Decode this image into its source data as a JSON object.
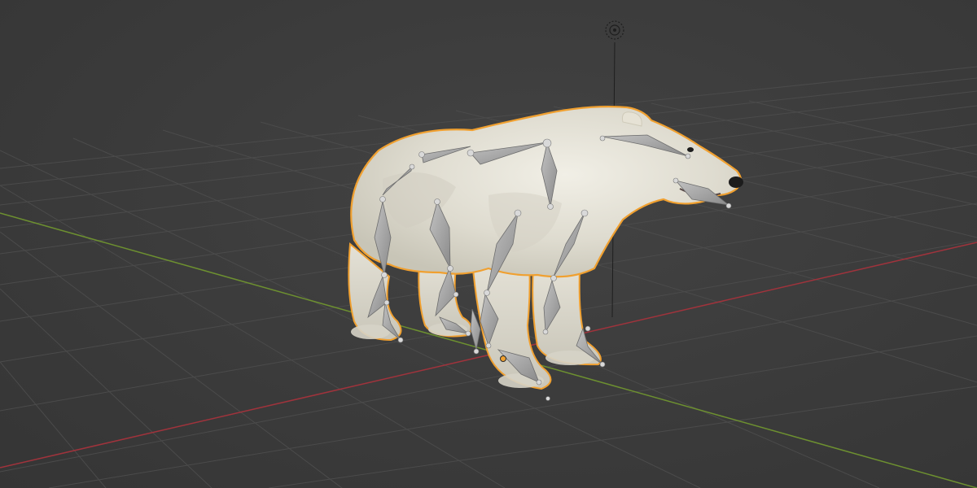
{
  "viewport": {
    "name": "3d-viewport",
    "colors": {
      "background": "#3d3d3d",
      "grid_line": "#4a4a4a",
      "x_axis": "#a0333c",
      "y_axis": "#6d9030",
      "selection_outline": "#f0a030",
      "bone": "#a8a8a8",
      "bone_joint": "#d9d9d9",
      "fur": "#e8e5d9",
      "nose": "#1c1c1c"
    },
    "objects": [
      {
        "name": "polar-bear-mesh",
        "type": "mesh",
        "selected": true
      },
      {
        "name": "armature",
        "type": "armature",
        "display": "octahedral"
      },
      {
        "name": "camera-target-empty",
        "type": "empty"
      }
    ]
  }
}
